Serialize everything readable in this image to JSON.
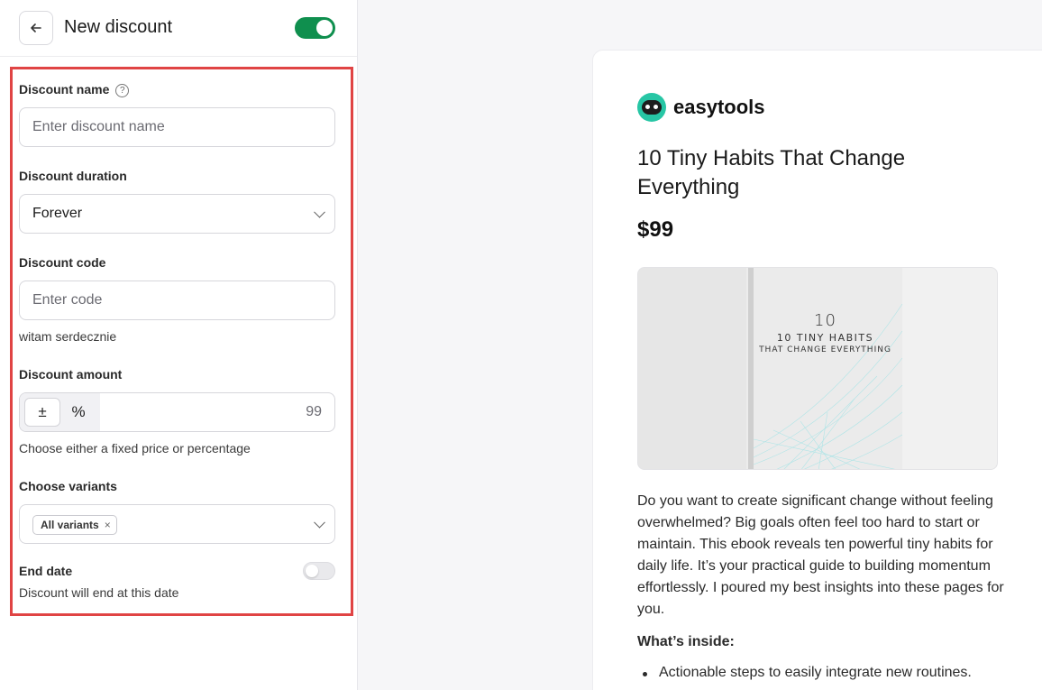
{
  "header": {
    "title": "New discount",
    "enabled": true
  },
  "form": {
    "name": {
      "label": "Discount name",
      "placeholder": "Enter discount name",
      "value": ""
    },
    "duration": {
      "label": "Discount duration",
      "value": "Forever"
    },
    "code": {
      "label": "Discount code",
      "placeholder": "Enter code",
      "value": "",
      "hint": "witam serdecznie"
    },
    "amount": {
      "label": "Discount amount",
      "fixed_symbol": "±",
      "percent_symbol": "%",
      "active_mode": "fixed",
      "value": "99",
      "hint": "Choose either a fixed price or percentage"
    },
    "variants": {
      "label": "Choose variants",
      "chip": "All variants",
      "chip_remove": "×"
    },
    "end_date": {
      "label": "End date",
      "hint": "Discount will end at this date",
      "enabled": false
    }
  },
  "preview": {
    "brand": "easytools",
    "title": "10 Tiny Habits That Change Everything",
    "price": "$99",
    "cover": {
      "num": "10",
      "line1": "10 TINY HABITS",
      "line2": "THAT CHANGE EVERYTHING"
    },
    "description": "Do you want to create significant change without feeling overwhelmed? Big goals often feel too hard to start or maintain. This ebook reveals ten powerful tiny habits for daily life. It’s your practical guide to building momentum effortlessly. I poured my best insights into these pages for you.",
    "inside_heading": "What’s inside:",
    "bullets": [
      "Actionable steps to easily integrate new routines."
    ]
  },
  "colors": {
    "accent_green": "#0f8f4e",
    "highlight_border": "#e04444",
    "logo_teal": "#27c6a5"
  },
  "icons": {
    "back": "arrow-left-icon",
    "help": "question-circle-icon",
    "dropdown": "chevron-down-icon",
    "remove": "close-icon"
  }
}
